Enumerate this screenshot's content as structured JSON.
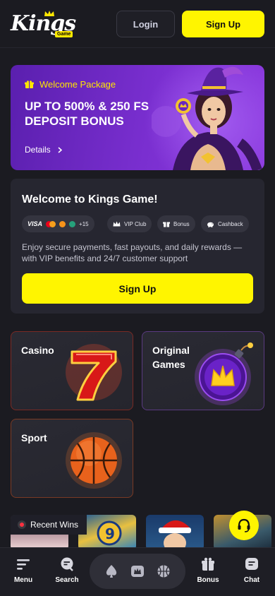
{
  "header": {
    "logo_text": "Kings",
    "logo_badge": "Game",
    "login_label": "Login",
    "signup_label": "Sign Up"
  },
  "promo": {
    "tag": "Welcome Package",
    "title": "UP TO 500% & 250 FS DEPOSIT BONUS",
    "details_label": "Details"
  },
  "welcome": {
    "title": "Welcome to Kings Game!",
    "chips": {
      "payments_visa": "VISA",
      "payments_more": "+15",
      "vip": "VIP Club",
      "bonus": "Bonus",
      "cashback": "Cashback"
    },
    "text": "Enjoy secure payments, fast payouts, and daily rewards — with VIP benefits and 24/7 customer support",
    "signup_label": "Sign Up"
  },
  "categories": {
    "casino": "Casino",
    "original": "Original Games",
    "sport": "Sport"
  },
  "recent_wins": {
    "label": "Recent Wins"
  },
  "bottom_nav": {
    "menu": "Menu",
    "search": "Search",
    "bonus": "Bonus",
    "chat": "Chat"
  },
  "colors": {
    "accent": "#fff500",
    "background": "#1b1b21",
    "card": "#262630",
    "promo_purple": "#7a2fd0"
  }
}
